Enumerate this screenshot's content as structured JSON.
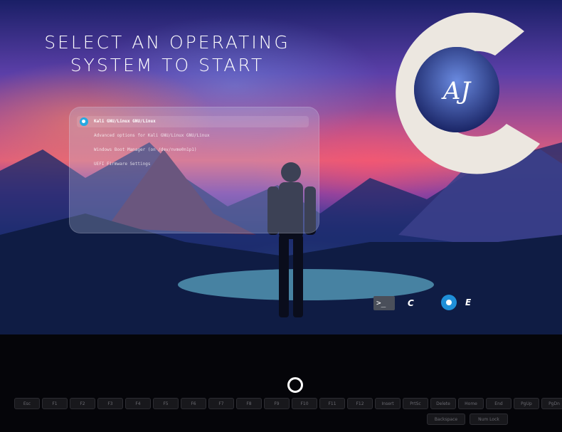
{
  "title": {
    "line1": "SELECT AN OPERATING",
    "line2": "SYSTEM TO START"
  },
  "menu": {
    "items": [
      {
        "label": "Kali GNU/Linux GNU/Linux"
      },
      {
        "label": "Advanced options for Kali GNU/Linux GNU/Linux"
      },
      {
        "label": "Windows Boot Manager (on /dev/nvme0n1p1)"
      },
      {
        "label": "UEFI Firmware Settings"
      }
    ],
    "selected_index": 0
  },
  "logo": {
    "text": "AJ"
  },
  "footer": {
    "console_key": "C",
    "editor_key": "E"
  },
  "keyboard": {
    "row1": [
      "Esc",
      "F1",
      "F2",
      "F3",
      "F4",
      "F5",
      "F6",
      "F7",
      "F8",
      "F9",
      "F10",
      "F11",
      "F12",
      "Insert",
      "PrtSc",
      "Delete",
      "Home",
      "End",
      "PgUp",
      "PgDn"
    ],
    "row2_visible": [
      "Backspace",
      "Num Lock"
    ]
  },
  "colors": {
    "accent": "#27a9e1",
    "panel": "rgba(190,200,235,.28)",
    "text": "#ffffff"
  },
  "icons": [
    "kali-dragon-icon",
    "terminal-icon",
    "setup-gear-icon",
    "loading-spinner-icon"
  ]
}
